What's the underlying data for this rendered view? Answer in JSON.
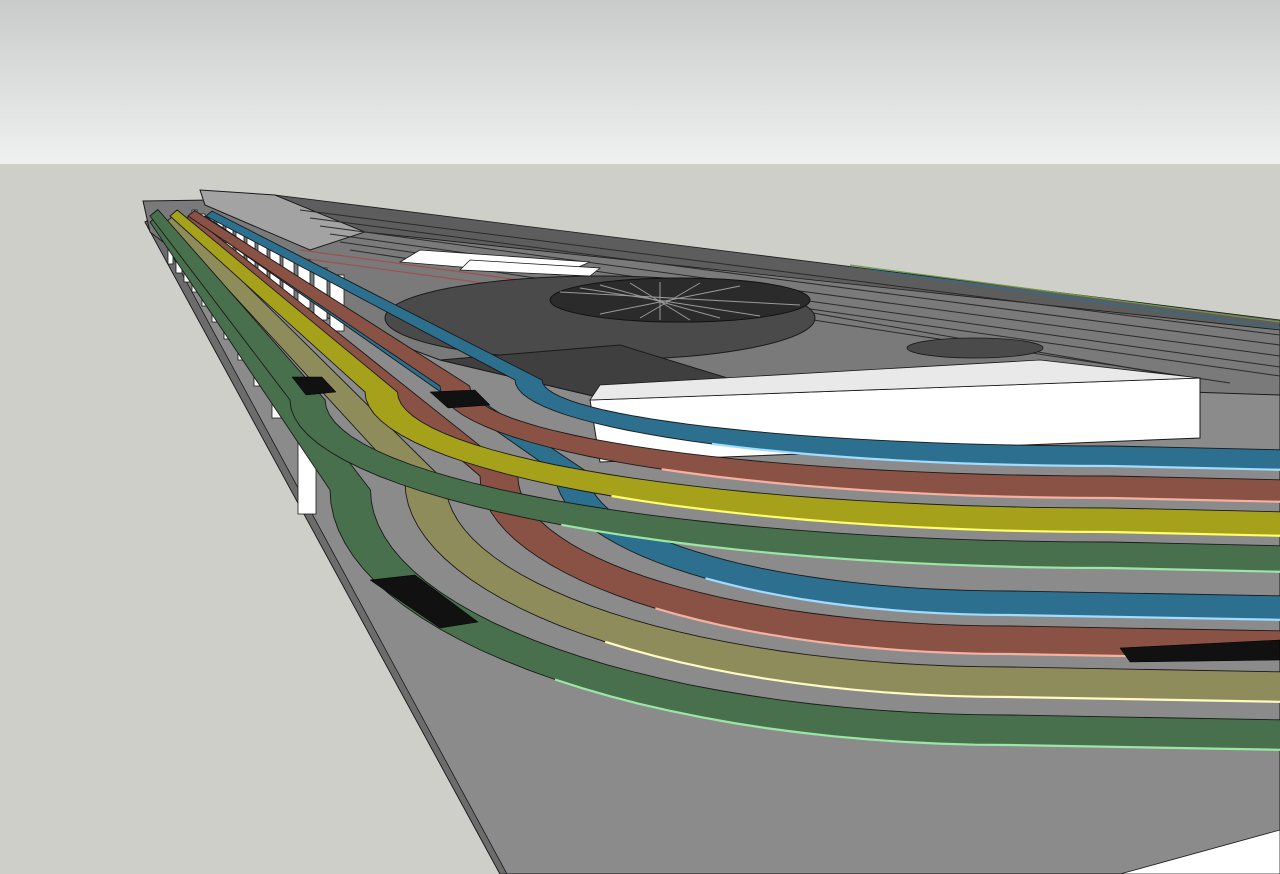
{
  "scene": {
    "colors": {
      "sky_top": "#c9cbcb",
      "sky_bottom": "#eff0f0",
      "ground": "#cfcfca",
      "base_board": "#8b8b8b",
      "base_board_edge": "#6c6c6c",
      "upper_deck": "#7a7a7a",
      "upper_deck_dark": "#3f3f3f",
      "upper_deck_white": "#ffffff",
      "track_blue": "#2c6f8e",
      "track_blue_edge": "#9fdcff",
      "track_red": "#8a5145",
      "track_red_edge": "#f7b0a0",
      "track_yellow": "#a5a11a",
      "track_yellow_edge": "#ffff6a",
      "track_olive": "#8f8c5c",
      "track_olive_edge": "#fffac0",
      "track_green": "#48704c",
      "track_green_edge": "#9be6a5",
      "pillar": "#ffffff",
      "outline": "#1a1a1a"
    }
  }
}
